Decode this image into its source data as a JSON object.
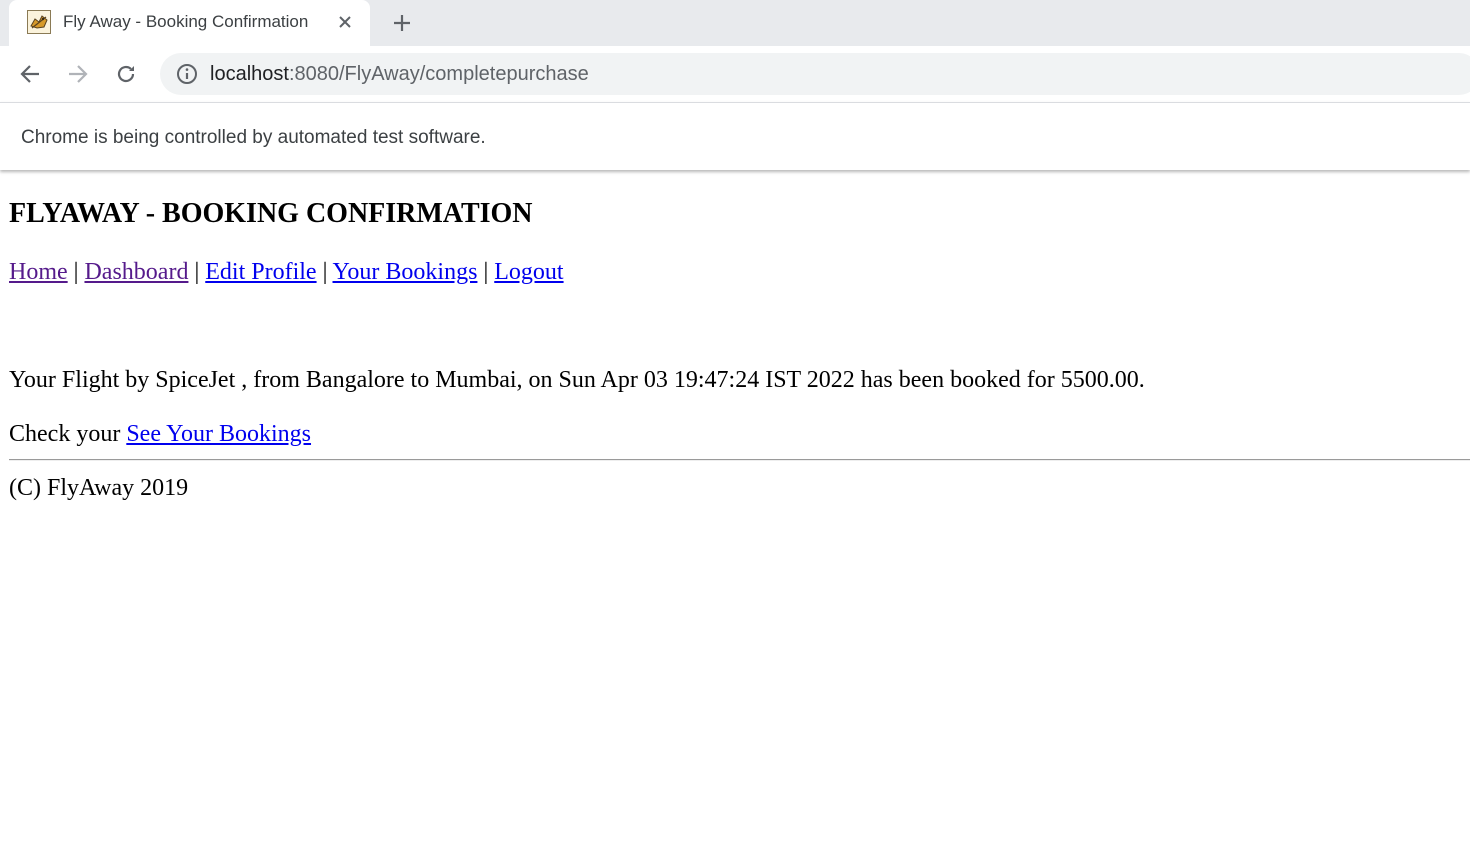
{
  "browser": {
    "tab": {
      "title": "Fly Away - Booking Confirmation",
      "favicon": "tomcat-favicon-icon"
    },
    "address_bar": {
      "host": "localhost",
      "path": ":8080/FlyAway/completepurchase"
    },
    "infobar": {
      "message": "Chrome is being controlled by automated test software."
    }
  },
  "page": {
    "heading": "FLYAWAY - BOOKING CONFIRMATION",
    "nav": {
      "home": "Home",
      "dashboard": "Dashboard",
      "edit_profile": "Edit Profile",
      "your_bookings": "Your Bookings",
      "logout": "Logout",
      "separator": "|"
    },
    "confirmation_message": "Your Flight by SpiceJet , from Bangalore to Mumbai, on Sun Apr 03 19:47:24 IST 2022 has been booked for 5500.00.",
    "check_prefix": "Check your",
    "see_bookings_link": "See Your Bookings",
    "footer": "(C) FlyAway 2019"
  },
  "colors": {
    "tabstrip": "#e8eaed",
    "omnibox": "#f1f3f4",
    "link": "#0000ee",
    "visited_link": "#551a8b"
  }
}
